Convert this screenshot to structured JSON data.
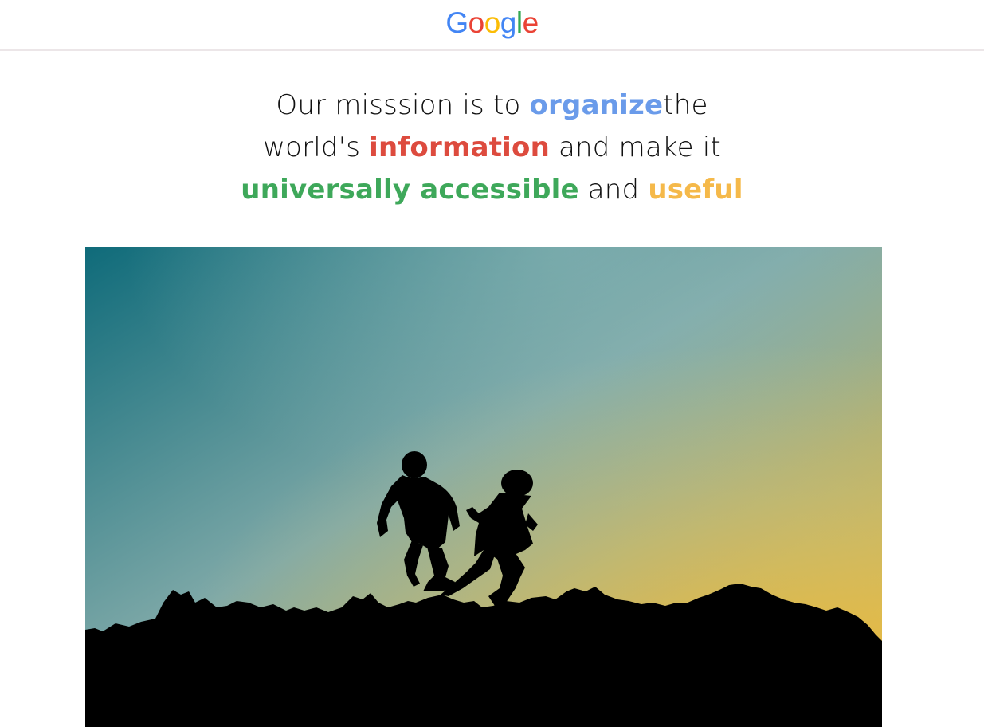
{
  "header": {
    "logo": {
      "letters": [
        {
          "char": "G",
          "color": "#4285f4"
        },
        {
          "char": "o",
          "color": "#ea4335"
        },
        {
          "char": "o",
          "color": "#fbbc05"
        },
        {
          "char": "g",
          "color": "#4285f4"
        },
        {
          "char": "l",
          "color": "#34a853"
        },
        {
          "char": "e",
          "color": "#ea4335"
        }
      ]
    }
  },
  "mission": {
    "line1_a": "Our misssion is to ",
    "line1_hl": "organize",
    "line1_b": "the",
    "line2_a": "world's ",
    "line2_hl": "information",
    "line2_b": " and make it",
    "line3_hl1": "universally accessible",
    "line3_mid": " and ",
    "line3_hl2": "useful",
    "colors": {
      "organize": "#6a9bea",
      "information": "#dd4b3e",
      "universally_accessible": "#3ea85a",
      "useful": "#f5b94a"
    }
  },
  "hero": {
    "image": "silhouette-children-jumping-sunset",
    "sky_colors": {
      "top_left": "#0f6b7a",
      "middle": "#7fa9a8",
      "bottom_right": "#e7b834"
    }
  }
}
